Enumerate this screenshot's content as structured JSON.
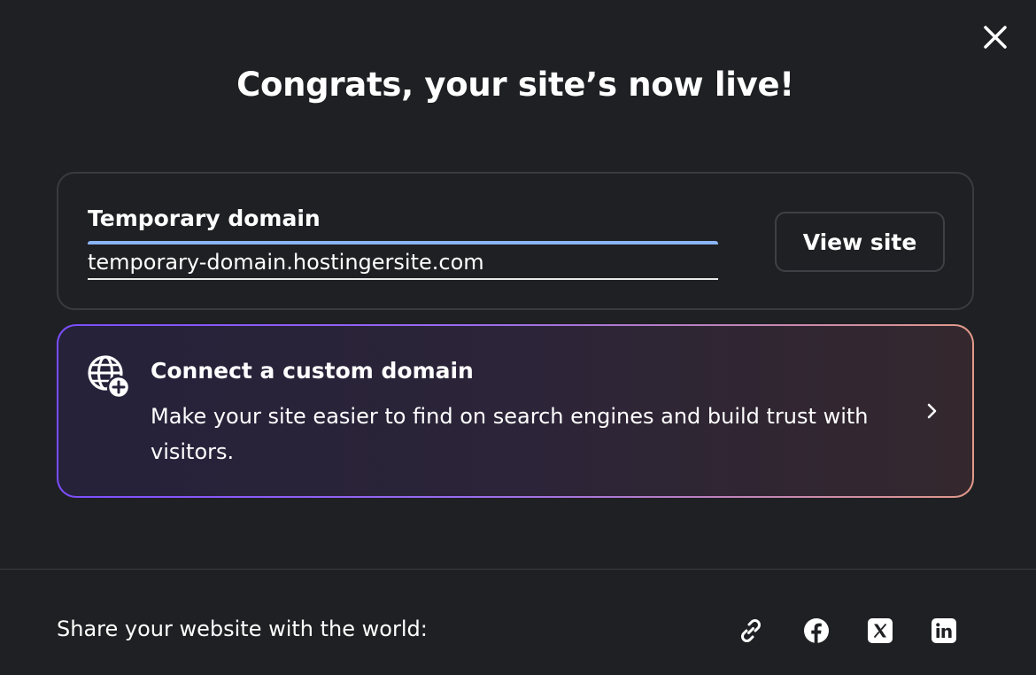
{
  "dialog": {
    "title": "Congrats, your site’s now live!",
    "close_icon": "close-icon"
  },
  "temporary_domain": {
    "label": "Temporary domain",
    "value": "temporary-domain.hostingersite.com",
    "view_site_label": "View site"
  },
  "custom_domain": {
    "icon": "globe-plus-icon",
    "title": "Connect a custom domain",
    "description": "Make your site easier to find on search engines and build trust with visitors.",
    "chevron_icon": "chevron-right-icon"
  },
  "share": {
    "label": "Share your website with the world:",
    "buttons": [
      "link-icon",
      "facebook-icon",
      "x-icon",
      "linkedin-icon"
    ]
  },
  "colors": {
    "background": "#1f2023",
    "border": "#3a3b40",
    "field_accent": "#8ab4f8",
    "gradient_start": "#7c4dff",
    "gradient_end": "#e29a8a"
  }
}
